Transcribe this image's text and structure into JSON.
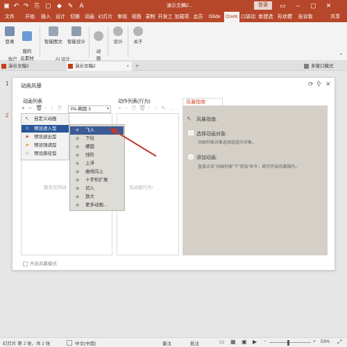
{
  "titlebar": {
    "doc_title": "演示文稿2...",
    "login": "登录",
    "qat": [
      "save-icon",
      "undo-icon",
      "redo-icon",
      "format-icon",
      "picture-icon",
      "fill-icon",
      "pen-icon",
      "font-color-icon"
    ]
  },
  "menu": [
    "文件",
    "开始",
    "插入",
    "设计",
    "切换",
    "动画",
    "幻灯片",
    "审阅",
    "视图",
    "录制",
    "开发工",
    "加载项",
    "会员",
    "iSlide",
    "OneK",
    "口袋动",
    "新建选",
    "形状模式",
    "告诉我",
    "共享"
  ],
  "menu_active_index": 14,
  "ribbon": {
    "buttons": [
      {
        "label": "登录"
      },
      {
        "label": "我的\n云素材"
      },
      {
        "label": "智能图文"
      },
      {
        "label": "智能设计"
      },
      {
        "label": "动\n画"
      },
      {
        "label": "设计"
      },
      {
        "label": "关于"
      }
    ],
    "groups": [
      "账户",
      "AI 设计"
    ]
  },
  "tabs": [
    {
      "label": "演示文稿2"
    },
    {
      "label": "演示文稿2"
    },
    {
      "label": "多窗口模式"
    }
  ],
  "slide_numbers": [
    "1",
    "2"
  ],
  "dialog": {
    "title": "动画风暴",
    "col1_title": "动画列表",
    "col2_title": "动作列表(行为)",
    "guide_tab": "风暴指南",
    "select_value": "PA-椭圆 3",
    "menu_items": [
      "自定义动画",
      "预设进入型",
      "预设退出型",
      "预设强调型",
      "预设路径型"
    ],
    "submenu_items": [
      "飞入",
      "下拉",
      "螺旋",
      "线形",
      "上浮",
      "曲线向上",
      "十字形扩展",
      "切入",
      "放大",
      "更多动画..."
    ],
    "empty1": "暂无任何动",
    "empty2": "无动画行为!",
    "guide_heading": "风暴指南:",
    "guide_step1": "选择动画对象:",
    "guide_step1_sub": "动画列表对象选择组选中对象。",
    "guide_step2": "添加动画:",
    "guide_step2_sub": "直接点击\"动画列表\"下\"添加\"命令，即可开始风暴操作。",
    "open_storm_mode": "开启风暴模式"
  },
  "status": {
    "slide": "幻灯片 第 2 张，共 2 张",
    "lang": "中文(中国)",
    "notes": "备注",
    "comments": "批注",
    "zoom": "53%"
  },
  "colors": {
    "brand": "#b7472a",
    "menu_selected": "#2b579a",
    "submenu_selected": "#3c5a96",
    "annotation_arrow": "#c0392b"
  }
}
